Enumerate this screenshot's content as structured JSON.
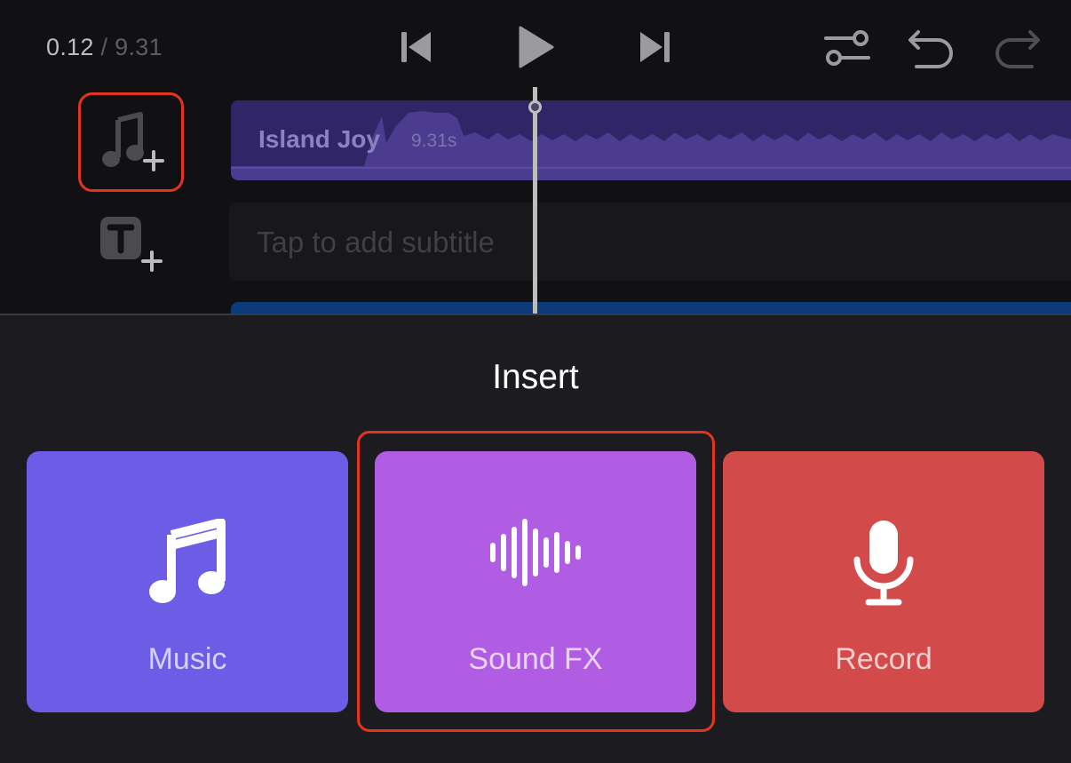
{
  "player": {
    "current_time": "0.12",
    "separator": " / ",
    "total_time": "9.31"
  },
  "timeline": {
    "music_track": {
      "title": "Island Joy",
      "duration": "9.31s",
      "color": "#302566"
    },
    "subtitle_track": {
      "placeholder": "Tap to add subtitle"
    }
  },
  "insert_panel": {
    "title": "Insert",
    "options": [
      {
        "label": "Music",
        "icon": "music-note-icon",
        "color": "#6d5ce5"
      },
      {
        "label": "Sound FX",
        "icon": "waveform-icon",
        "color": "#b05de3"
      },
      {
        "label": "Record",
        "icon": "microphone-icon",
        "color": "#d24a4a"
      }
    ]
  },
  "highlight_color": "#e4341f"
}
